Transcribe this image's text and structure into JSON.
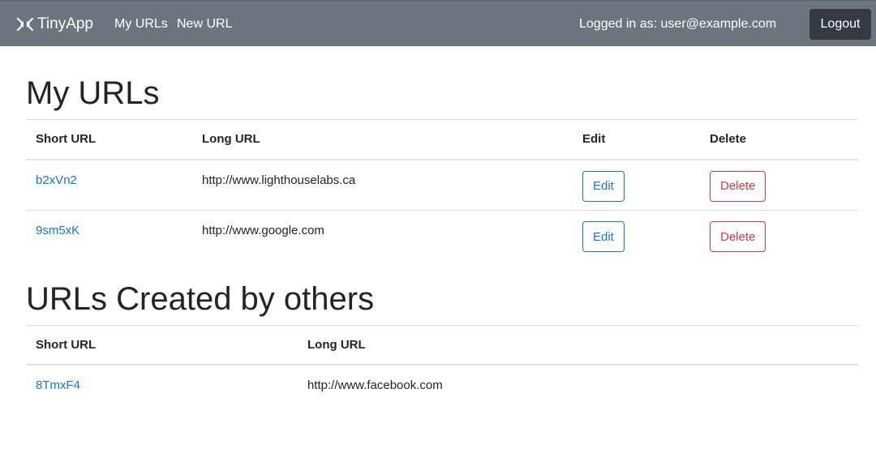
{
  "navbar": {
    "brand": "TinyApp",
    "brand_icon": "shrink-arrows-icon",
    "links": [
      "My URLs",
      "New URL"
    ],
    "logged_in_text": "Logged in as: user@example.com",
    "logout_label": "Logout"
  },
  "my_urls": {
    "title": "My URLs",
    "headers": [
      "Short URL",
      "Long URL",
      "Edit",
      "Delete"
    ],
    "rows": [
      {
        "short": "b2xVn2",
        "long": "http://www.lighthouselabs.ca",
        "edit": "Edit",
        "delete": "Delete"
      },
      {
        "short": "9sm5xK",
        "long": "http://www.google.com",
        "edit": "Edit",
        "delete": "Delete"
      }
    ]
  },
  "others_urls": {
    "title": "URLs Created by others",
    "headers": [
      "Short URL",
      "Long URL"
    ],
    "rows": [
      {
        "short": "8TmxF4",
        "long": "http://www.facebook.com"
      }
    ]
  },
  "colors": {
    "navbar_bg": "#6c757d",
    "logout_bg": "#343a40",
    "link": "#1a73d9",
    "danger": "#dc3545"
  }
}
